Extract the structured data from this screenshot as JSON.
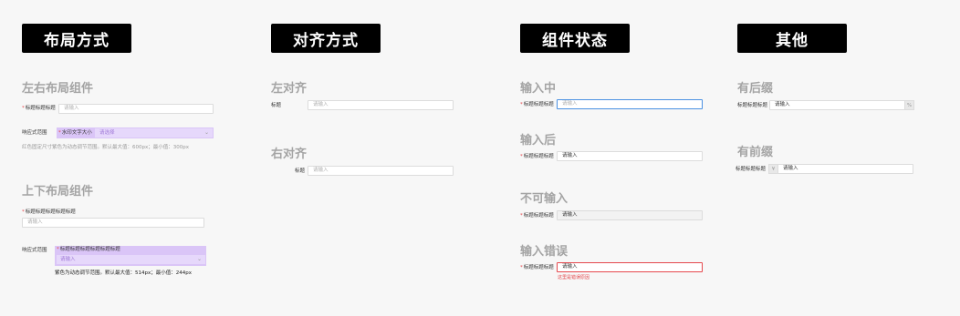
{
  "headers": {
    "layout": "布局方式",
    "align": "对齐方式",
    "state": "组件状态",
    "other": "其他"
  },
  "layout": {
    "lr_heading": "左右布局组件",
    "lr_label": "标题标题标题",
    "lr_placeholder": "请输入",
    "resp_label": "响应式范围",
    "resp_small_label": "水印文字大小",
    "resp_select_placeholder": "请选择",
    "resp_hint": "红色固定尺寸紫色为动态调节范围。默认最大值：600px；最小值：300px",
    "tb_heading": "上下布局组件",
    "tb_label": "标题标题标题标题标题",
    "tb_placeholder": "请输入",
    "resp2_label": "响应式范围",
    "resp2_small_label": "标题标题标题标题标题标题",
    "resp2_placeholder": "请输入",
    "resp2_hint": "紫色为动态调节范围。默认最大值：514px；最小值：244px"
  },
  "align": {
    "left_heading": "左对齐",
    "left_label": "标题",
    "left_placeholder": "请输入",
    "right_heading": "右对齐",
    "right_label": "标题",
    "right_placeholder": "请输入"
  },
  "state": {
    "typing_heading": "输入中",
    "typing_label": "标题标题标题",
    "typing_value": "请输入",
    "after_heading": "输入后",
    "after_label": "标题标题标题",
    "after_value": "请输入",
    "disabled_heading": "不可输入",
    "disabled_label": "标题标题标题",
    "disabled_value": "请输入",
    "error_heading": "输入错误",
    "error_label": "标题标题标题",
    "error_value": "请输入",
    "error_message": "这里是错误原因"
  },
  "other": {
    "suffix_heading": "有后缀",
    "suffix_label": "标题标题标题",
    "suffix_value": "请输入",
    "suffix_addon": "%",
    "prefix_heading": "有前缀",
    "prefix_label": "标题标题标题",
    "prefix_addon": "¥",
    "prefix_value": "请输入"
  }
}
